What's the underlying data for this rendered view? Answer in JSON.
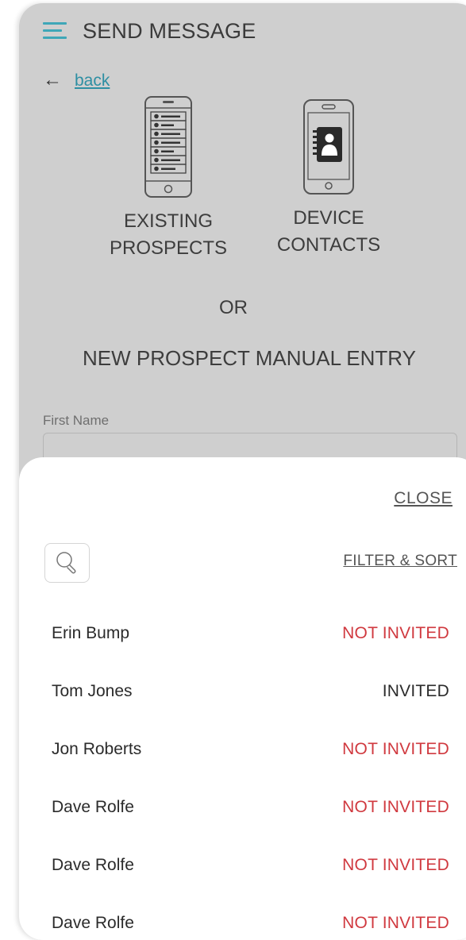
{
  "header": {
    "title": "SEND MESSAGE"
  },
  "nav": {
    "back_label": "back",
    "back_arrow": "←"
  },
  "choices": {
    "existing": {
      "line1": "EXISTING",
      "line2": "PROSPECTS",
      "icon": "phone-list-icon"
    },
    "device": {
      "line1": "DEVICE",
      "line2": "CONTACTS",
      "icon": "phone-contacts-icon"
    }
  },
  "or_text": "OR",
  "manual_entry": "NEW PROSPECT MANUAL ENTRY",
  "form": {
    "first_name_label": "First Name",
    "first_name_value": ""
  },
  "sheet": {
    "close_label": "CLOSE",
    "filter_label": "FILTER & SORT",
    "rows": [
      {
        "name": "Erin Bump",
        "status": "NOT INVITED",
        "invited": false
      },
      {
        "name": "Tom Jones",
        "status": "INVITED",
        "invited": true
      },
      {
        "name": "Jon Roberts",
        "status": "NOT INVITED",
        "invited": false
      },
      {
        "name": "Dave Rolfe",
        "status": "NOT INVITED",
        "invited": false
      },
      {
        "name": "Dave Rolfe",
        "status": "NOT INVITED",
        "invited": false
      },
      {
        "name": "Dave Rolfe",
        "status": "NOT INVITED",
        "invited": false
      }
    ]
  },
  "colors": {
    "accent": "#3ea7b8",
    "link": "#2e8fa3",
    "not_invited": "#d0393f",
    "overlay_bg": "#cfcfcf"
  }
}
